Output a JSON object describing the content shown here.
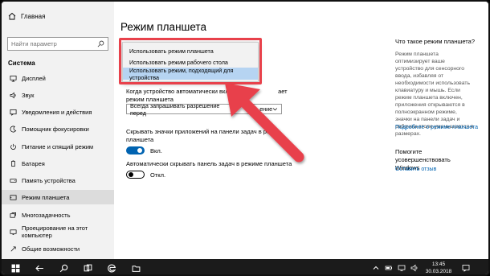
{
  "sidebar": {
    "home_label": "Главная",
    "search_placeholder": "Найти параметр",
    "section_title": "Система",
    "items": [
      {
        "label": "Дисплей",
        "icon": "display-icon"
      },
      {
        "label": "Звук",
        "icon": "sound-icon"
      },
      {
        "label": "Уведомления и действия",
        "icon": "notifications-icon"
      },
      {
        "label": "Помощник фокусировки",
        "icon": "focus-assist-icon"
      },
      {
        "label": "Питание и спящий режим",
        "icon": "power-icon"
      },
      {
        "label": "Батарея",
        "icon": "battery-icon"
      },
      {
        "label": "Память устройства",
        "icon": "storage-icon"
      },
      {
        "label": "Режим планшета",
        "icon": "tablet-icon"
      },
      {
        "label": "Многозадачность",
        "icon": "multitasking-icon"
      },
      {
        "label": "Проецирование на этот компьютер",
        "icon": "projecting-icon"
      },
      {
        "label": "Общие возможности",
        "icon": "shared-experiences-icon"
      }
    ],
    "active_item": "Режим планшета"
  },
  "main": {
    "title": "Режим планшета",
    "dropdown_options": [
      "Использовать режим планшета",
      "Использовать режим рабочего стола",
      "Использовать режим, подходящий для устройства"
    ],
    "selected_option_index": 2,
    "when_label": "Когда устройство автоматически включ… … … …ключает режим планшета",
    "when_label_line1": "Когда устройство автоматически включ",
    "when_label_line1_tail": "ает",
    "when_label_line2": "режим планшета",
    "combo_value": "Всегда запрашивать разрешение перед",
    "combo_value_tail": "ение",
    "option1_line1": "Скрывать значки приложений на панели задач в режи",
    "option1_line2": "планшета",
    "option1_state": "Вкл.",
    "option2_label": "Автоматически скрывать панель задач в режиме планшета",
    "option2_state": "Откл."
  },
  "info": {
    "title": "Что такое режим планшета?",
    "text": "Режим планшета оптимизирует ваше устройство для сенсорного ввода, избавляя от необходимости использовать клавиатуру и мышь. Если режим планшета включен, приложения открываются в полноэкранном режиме, значки на панели задач и рабочем столе уменьшаются в размерах.",
    "link": "Подробнее о режиме планшета",
    "help_title": "Помогите усовершенствовать Windows",
    "help_link": "Оставить отзыв"
  },
  "taskbar": {
    "time": "13:45",
    "date": "30.03.2018"
  },
  "colors": {
    "accent": "#0063b1",
    "highlight_frame": "#e8414b",
    "selected_option_bg": "#b6d4f2",
    "taskbar_bg": "#1b1b1b"
  }
}
